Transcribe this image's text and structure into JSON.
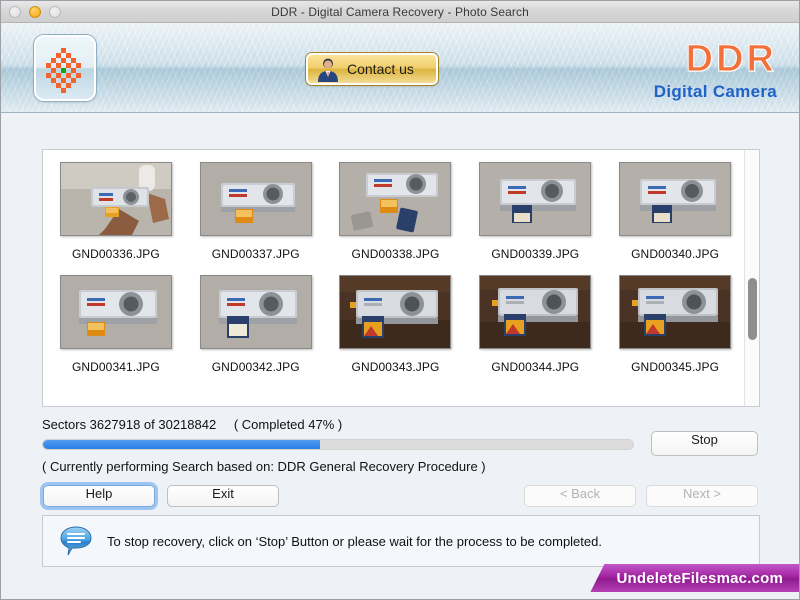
{
  "window": {
    "title": "DDR - Digital Camera Recovery - Photo Search",
    "traffic_lights": {
      "close": "close-button",
      "minimize": "minimize-button",
      "zoom": "zoom-button"
    }
  },
  "toolbar": {
    "logo_icon": "ddr-checker-flower-logo",
    "contact_label": "Contact us",
    "contact_icon": "person-avatar-icon",
    "brand_title": "DDR",
    "brand_subtitle": "Digital Camera",
    "brand_color": "#f2703a",
    "brand_sub_color": "#1f62c8"
  },
  "thumbnails": {
    "rows": [
      [
        {
          "name": "GND00336.JPG",
          "scene": "hands-holding-camera"
        },
        {
          "name": "GND00337.JPG",
          "scene": "camera-with-orange-sd-card"
        },
        {
          "name": "GND00338.JPG",
          "scene": "camera-with-two-loose-cards"
        },
        {
          "name": "GND00339.JPG",
          "scene": "camera-with-blue-sd-card"
        },
        {
          "name": "GND00340.JPG",
          "scene": "camera-with-blue-sd-card"
        }
      ],
      [
        {
          "name": "GND00341.JPG",
          "scene": "camera-with-orange-sd-card"
        },
        {
          "name": "GND00342.JPG",
          "scene": "camera-with-blue-sd-card"
        },
        {
          "name": "GND00343.JPG",
          "scene": "camera-on-dark-wood"
        },
        {
          "name": "GND00344.JPG",
          "scene": "camera-on-dark-wood"
        },
        {
          "name": "GND00345.JPG",
          "scene": "camera-on-dark-wood"
        }
      ]
    ]
  },
  "status": {
    "sectors_text": "Sectors 3627918 of 30218842",
    "completed_text": "( Completed 47% )",
    "progress_percent": 47,
    "progress_fill_color": "#2b7fe6",
    "procedure_text": "( Currently performing Search based on: DDR General Recovery Procedure )"
  },
  "buttons": {
    "stop": "Stop",
    "help": "Help",
    "exit": "Exit",
    "back": "< Back",
    "next": "Next >"
  },
  "info": {
    "icon": "speech-bubble-info-icon",
    "message": "To stop recovery, click on ‘Stop’ Button or please wait for the process to be completed."
  },
  "watermark": {
    "text": "UndeleteFilesmac.com",
    "color": "#a0219f"
  }
}
